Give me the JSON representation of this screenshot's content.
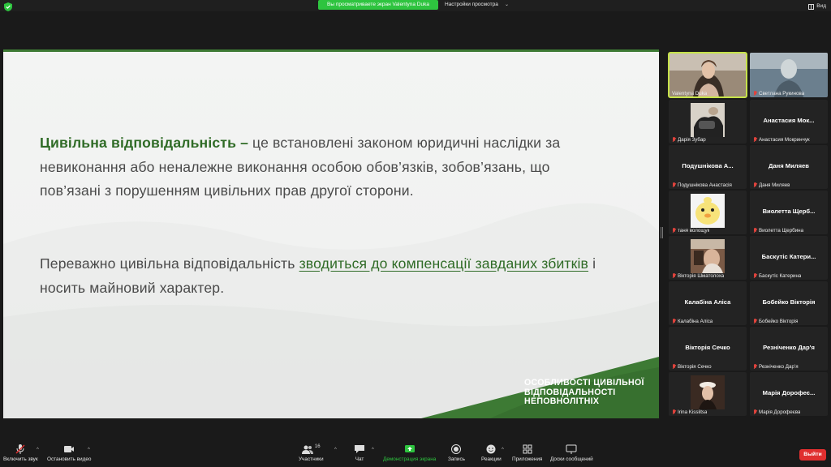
{
  "topbar": {
    "share_notice": "Вы просматриваете экран Valentyna Duka",
    "view_settings": "Настройки просмотра",
    "view_label": "Вид"
  },
  "slide": {
    "p1_term": "Цивільна відповідальність –",
    "p1_rest": " це встановлені законом юридичні наслідки за невиконання або неналежне виконання особою обов’язків, зобов’язань, що пов’язані з порушенням цивільних прав другої сторони.",
    "p2_start": "Переважно цивільна відповідальність ",
    "p2_hl": "зводиться до компенсації завданих збитків",
    "p2_end": " і носить майновий характер.",
    "title": "ОСОБЛИВОСТІ ЦИВІЛЬНОЇ ВІДПОВІДАЛЬНОСТІ НЕПОВНОЛІТНІХ",
    "accent_color": "#3d7a34"
  },
  "participants": [
    {
      "name": "",
      "label": "Valentyna Duka",
      "video": "person-video",
      "muted": false
    },
    {
      "name": "",
      "label": "Светлана Рукинова",
      "video": "person-video",
      "muted": true
    },
    {
      "name": "",
      "label": "Дарія Зубар",
      "video": "photo-avatar",
      "muted": true
    },
    {
      "name": "Анастасия Мок...",
      "label": "Анастасия Мокринчук",
      "video": "",
      "muted": true
    },
    {
      "name": "Подушнікова А...",
      "label": "Подушнікова Анастасія",
      "video": "",
      "muted": true
    },
    {
      "name": "Даня Миляев",
      "label": "Даня Миляев",
      "video": "",
      "muted": true
    },
    {
      "name": "",
      "label": "таня волощук",
      "video": "duck-avatar",
      "muted": true
    },
    {
      "name": "Виолетта Щерб...",
      "label": "Виолетта Щербина",
      "video": "",
      "muted": true
    },
    {
      "name": "",
      "label": "Вікторія Шматолоха",
      "video": "photo-avatar",
      "muted": true
    },
    {
      "name": "Баскутіс Катери...",
      "label": "Баскутіс Катерина",
      "video": "",
      "muted": true
    },
    {
      "name": "Калабіна Аліса",
      "label": "Калабіна Аліса",
      "video": "",
      "muted": true
    },
    {
      "name": "Бобейко Вікторія",
      "label": "Бобейко Вікторія",
      "video": "",
      "muted": true
    },
    {
      "name": "Вікторія Сечко",
      "label": "Вікторія Сечко",
      "video": "",
      "muted": true
    },
    {
      "name": "Резніченко Дар'я",
      "label": "Резніченко Дар’я",
      "video": "",
      "muted": true
    },
    {
      "name": "",
      "label": "Irina Kisslitsa",
      "video": "photo-avatar",
      "muted": true
    },
    {
      "name": "Марія Дорофеє...",
      "label": "Марія Дорофеєва",
      "video": "",
      "muted": true
    }
  ],
  "toolbar": {
    "unmute": "Включить звук",
    "stop_video": "Остановить видео",
    "participants": "Участники",
    "participants_count": "16",
    "chat": "Чат",
    "share_screen": "Демонстрация экрана",
    "record": "Запись",
    "reactions": "Реакции",
    "apps": "Приложения",
    "whiteboards": "Доски сообщений",
    "leave": "Выйти",
    "share_color": "#2ec43f",
    "leave_color": "#e02f2f"
  }
}
